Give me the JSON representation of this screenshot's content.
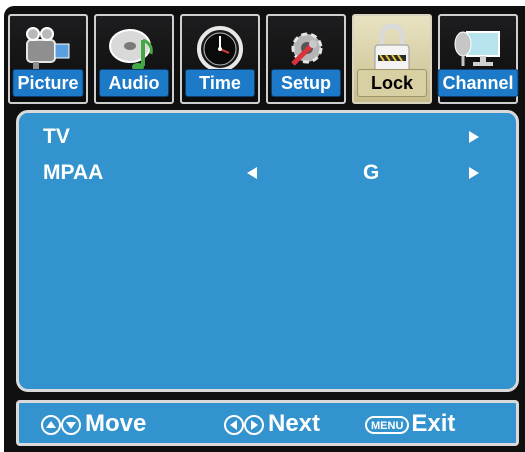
{
  "tabs": [
    {
      "label": "Picture",
      "icon": "camcorder-icon",
      "active": false
    },
    {
      "label": "Audio",
      "icon": "music-disc-icon",
      "active": false
    },
    {
      "label": "Time",
      "icon": "clock-icon",
      "active": false
    },
    {
      "label": "Setup",
      "icon": "gear-wrench-icon",
      "active": false
    },
    {
      "label": "Lock",
      "icon": "padlock-icon",
      "active": true
    },
    {
      "label": "Channel",
      "icon": "satellite-monitor-icon",
      "active": false
    }
  ],
  "menu": {
    "rows": [
      {
        "name": "TV",
        "value": "",
        "has_left_arrow": false,
        "has_right_arrow": true
      },
      {
        "name": "MPAA",
        "value": "G",
        "has_left_arrow": true,
        "has_right_arrow": true
      }
    ]
  },
  "footer": {
    "move_label": "Move",
    "next_label": "Next",
    "menu_key": "MENU",
    "exit_label": "Exit"
  },
  "colors": {
    "panel": "#3393cf",
    "frame": "#0f0f10",
    "active_tab": "#d8cfa3",
    "label_blue": "#1c7ac8"
  }
}
